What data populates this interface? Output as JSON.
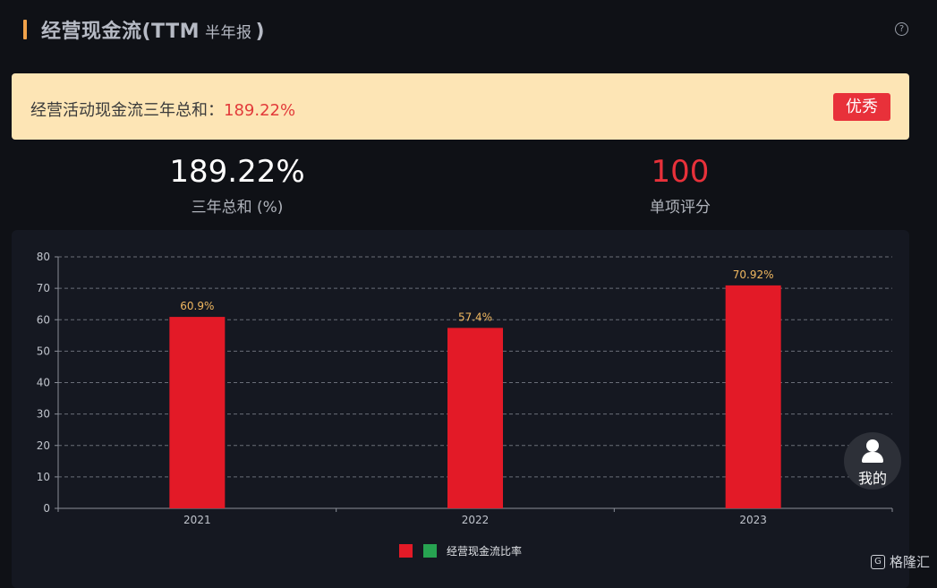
{
  "header": {
    "title": "经营现金流(TTM",
    "title_sub": "半年报",
    "title_close": ")",
    "help_icon": "?"
  },
  "banner": {
    "label": "经营活动现金流三年总和：",
    "value": "189.22%",
    "badge": "优秀"
  },
  "stats": {
    "total_value": "189.22%",
    "total_label": "三年总和 (%)",
    "score_value": "100",
    "score_label": "单项评分"
  },
  "chart_data": {
    "type": "bar",
    "categories": [
      "2021",
      "2022",
      "2023"
    ],
    "series": [
      {
        "name": "经营现金流比率",
        "values": [
          60.9,
          57.4,
          70.92
        ],
        "labels": [
          "60.9%",
          "57.4%",
          "70.92%"
        ],
        "color": "#e31a27"
      }
    ],
    "legend_extra_color": "#27a351",
    "yticks": [
      0,
      10,
      20,
      30,
      40,
      50,
      60,
      70,
      80
    ],
    "ylim": [
      0,
      80
    ],
    "grid": true,
    "legend_position": "bottom-center",
    "label_color": "#f0b860"
  },
  "fab": {
    "label": "我的"
  },
  "watermark": {
    "text": "格隆汇"
  }
}
